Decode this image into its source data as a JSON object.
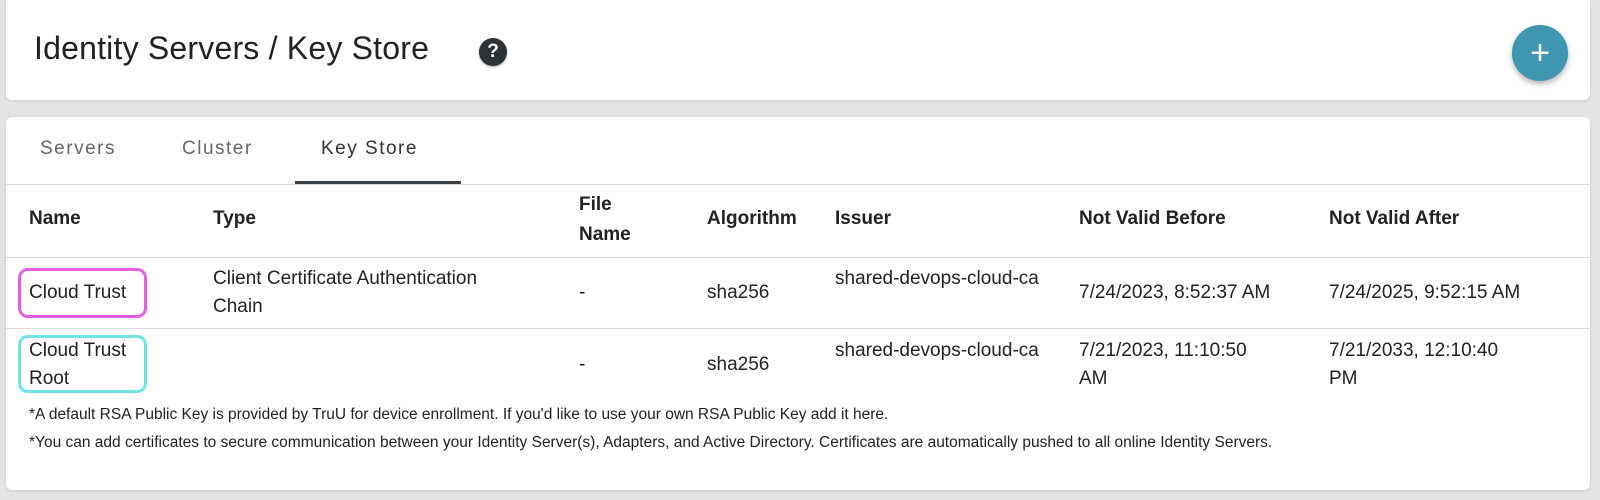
{
  "header": {
    "title": "Identity Servers / Key Store",
    "help_icon": "question-circle-icon",
    "help_glyph": "?",
    "add_icon": "plus-icon",
    "add_glyph": "+",
    "accent_color": "#3f96b0"
  },
  "tabs": [
    {
      "label": "Servers",
      "active": false
    },
    {
      "label": "Cluster",
      "active": false
    },
    {
      "label": "Key Store",
      "active": true
    }
  ],
  "table": {
    "columns": [
      "Name",
      "Type",
      "File\nName",
      "Algorithm",
      "Issuer",
      "Not Valid Before",
      "Not Valid After"
    ],
    "rows": [
      {
        "name": "Cloud Trust",
        "type": "Client Certificate Authentication Chain",
        "file_name": "-",
        "algorithm": "sha256",
        "issuer": "shared-devops-cloud-ca",
        "not_valid_before": "7/24/2023, 8:52:37 AM",
        "not_valid_after": "7/24/2025, 9:52:15 AM",
        "highlight_color": "#e35ee3"
      },
      {
        "name": "Cloud Trust Root",
        "type": "",
        "file_name": "-",
        "algorithm": "sha256",
        "issuer": "shared-devops-cloud-ca",
        "not_valid_before": "7/21/2023, 11:10:50 AM",
        "not_valid_after": "7/21/2033, 12:10:40 PM",
        "highlight_color": "#6fe3e6"
      }
    ]
  },
  "footnotes": [
    "*A default RSA Public Key is provided by TruU for device enrollment. If you'd like to use your own RSA Public Key add it here.",
    "*You can add certificates to secure communication between your Identity Server(s), Adapters, and Active Directory. Certificates are automatically pushed to all online Identity Servers."
  ]
}
